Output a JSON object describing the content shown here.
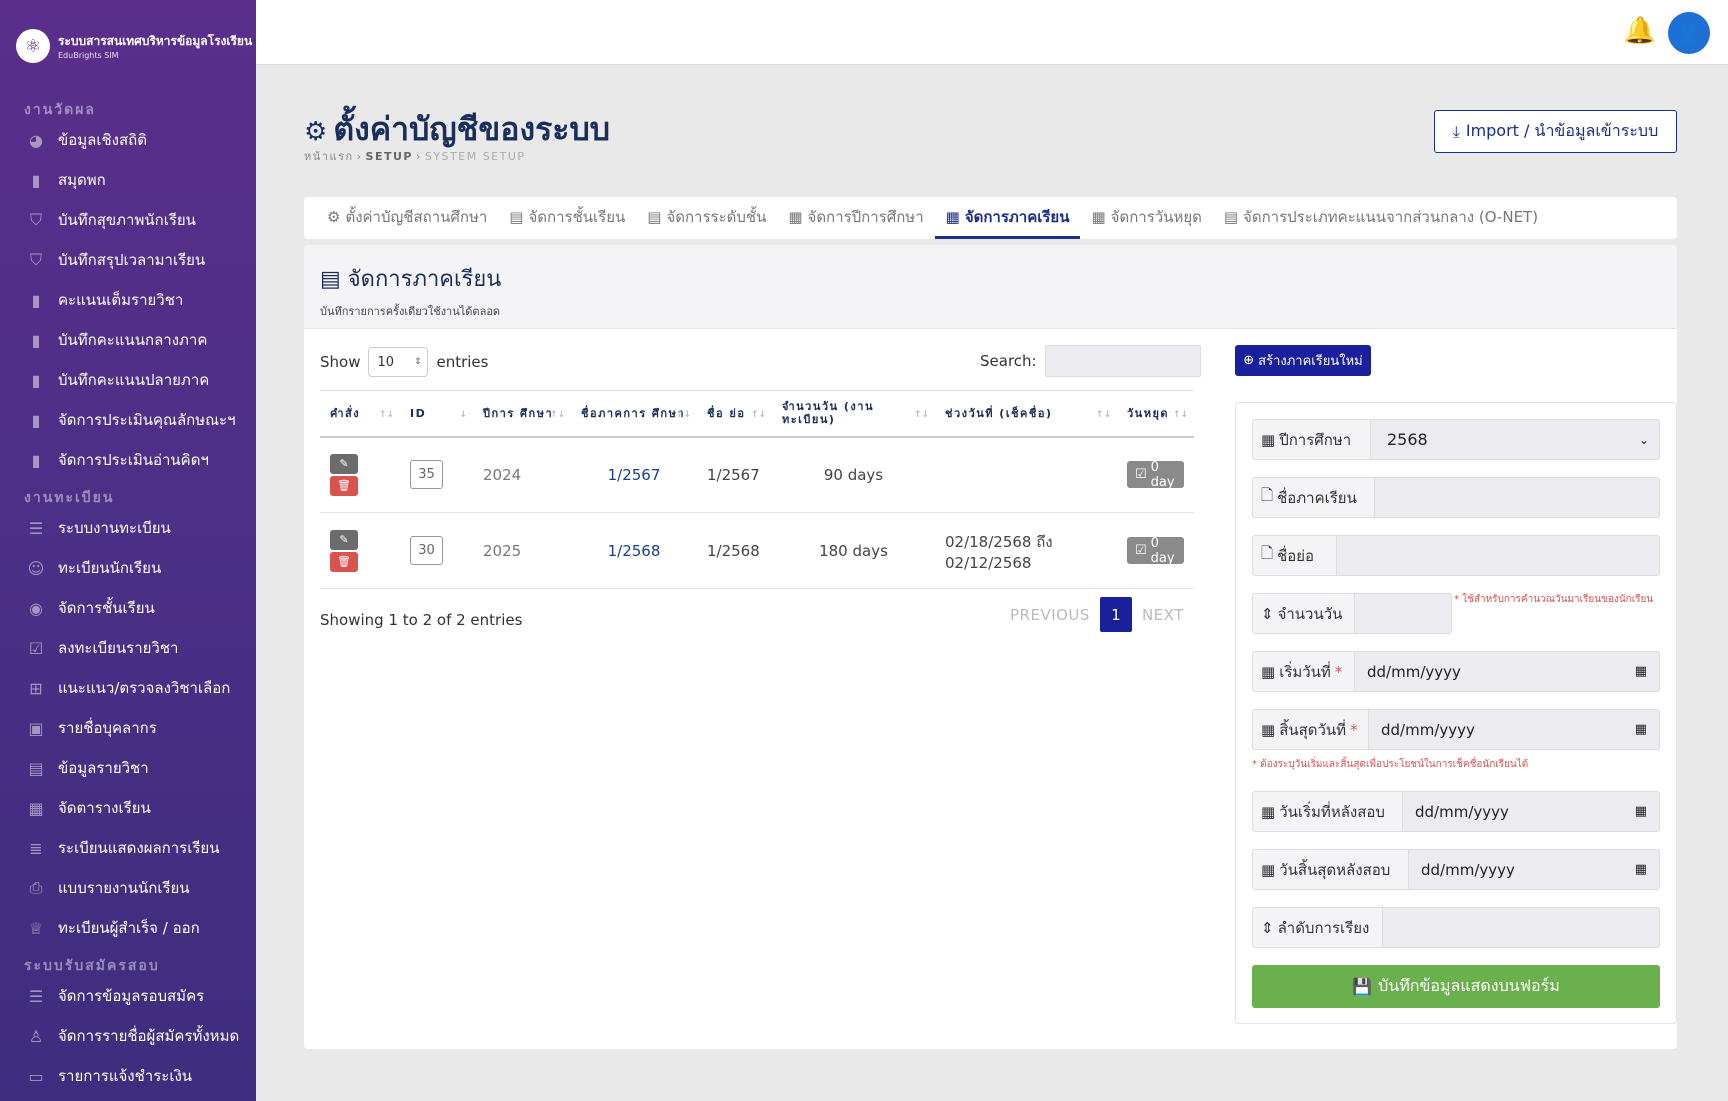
{
  "brand": {
    "title": "ระบบสารสนเทศบริหารข้อมูลโรงเรียน",
    "subtitle": "EduBrights SIM"
  },
  "sidebar": {
    "sections": [
      {
        "title": "งานวัดผล",
        "items": [
          {
            "label": "ข้อมูลเชิงสถิติ",
            "icon": "chart-pie-icon"
          },
          {
            "label": "สมุดพก",
            "icon": "book-icon"
          },
          {
            "label": "บันทึกสุขภาพนักเรียน",
            "icon": "shield-icon"
          },
          {
            "label": "บันทึกสรุปเวลามาเรียน",
            "icon": "shield-icon"
          },
          {
            "label": "คะแนนเต็มรายวิชา",
            "icon": "book-icon"
          },
          {
            "label": "บันทึกคะแนนกลางภาค",
            "icon": "book-icon"
          },
          {
            "label": "บันทึกคะแนนปลายภาค",
            "icon": "book-icon"
          },
          {
            "label": "จัดการประเมินคุณลักษณะฯ",
            "icon": "book-icon"
          },
          {
            "label": "จัดการประเมินอ่านคิดฯ",
            "icon": "book-icon"
          }
        ]
      },
      {
        "title": "งานทะเบียน",
        "items": [
          {
            "label": "ระบบงานทะเบียน",
            "icon": "list-icon"
          },
          {
            "label": "ทะเบียนนักเรียน",
            "icon": "face-icon"
          },
          {
            "label": "จัดการชั้นเรียน",
            "icon": "user-circle-icon"
          },
          {
            "label": "ลงทะเบียนรายวิชา",
            "icon": "checklist-icon"
          },
          {
            "label": "แนะแนว/ตรวจลงวิชาเลือก",
            "icon": "plus-box-icon"
          },
          {
            "label": "รายชื่อบุคลากร",
            "icon": "badge-icon"
          },
          {
            "label": "ข้อมูลรายวิชา",
            "icon": "open-book-icon"
          },
          {
            "label": "จัดตารางเรียน",
            "icon": "calendar-icon"
          },
          {
            "label": "ระเบียนแสดงผลการเรียน",
            "icon": "lines-icon"
          },
          {
            "label": "แบบรายงานนักเรียน",
            "icon": "printer-icon"
          },
          {
            "label": "ทะเบียนผู้สำเร็จ / ออก",
            "icon": "graduation-cap-icon"
          }
        ]
      },
      {
        "title": "ระบบรับสมัครสอบ",
        "items": [
          {
            "label": "จัดการข้อมูลรอบสมัคร",
            "icon": "list-icon"
          },
          {
            "label": "จัดการรายชื่อผู้สมัครทั้งหมด",
            "icon": "user-icon"
          },
          {
            "label": "รายการแจ้งชำระเงิน",
            "icon": "payment-icon"
          }
        ]
      }
    ]
  },
  "page": {
    "title": "ตั้งค่าบัญชีของระบบ",
    "breadcrumb": [
      "หน้าแรก",
      "SETUP",
      "SYSTEM SETUP"
    ],
    "import_label": "Import / นำข้อมูลเข้าระบบ"
  },
  "tabs": [
    {
      "label": "ตั้งค่าบัญชีสถานศึกษา",
      "icon": "gear-icon",
      "active": false
    },
    {
      "label": "จัดการชั้นเรียน",
      "icon": "list-alt-icon",
      "active": false
    },
    {
      "label": "จัดการระดับชั้น",
      "icon": "list-alt-icon",
      "active": false
    },
    {
      "label": "จัดการปีการศึกษา",
      "icon": "calendar-icon",
      "active": false
    },
    {
      "label": "จัดการภาคเรียน",
      "icon": "calendar-icon",
      "active": true
    },
    {
      "label": "จัดการวันหยุด",
      "icon": "calendar-icon",
      "active": false
    },
    {
      "label": "จัดการประเภทคะแนนจากส่วนกลาง (O-NET)",
      "icon": "list-alt-icon",
      "active": false
    }
  ],
  "card": {
    "title": "จัดการภาคเรียน",
    "subtitle": "บันทึกรายการครั้งเดียวใช้งานได้ตลอด"
  },
  "table": {
    "show_label": "Show",
    "entries_label": "entries",
    "length_value": "10",
    "search_label": "Search:",
    "columns": [
      "คำสั่ง",
      "ID",
      "ปีการ ศึกษา",
      "ชื่อภาคการ ศึกษา",
      "ชื่อ ย่อ",
      "จำนวนวัน (งาน ทะเบียน)",
      "ช่วงวันที่ (เช็คชื่อ)",
      "วันหยุด"
    ],
    "rows": [
      {
        "id": "35",
        "year": "2024",
        "term_name": "1/2567",
        "short": "1/2567",
        "days": "90 days",
        "range1": "",
        "range2": "",
        "holiday": "0 day"
      },
      {
        "id": "30",
        "year": "2025",
        "term_name": "1/2568",
        "short": "1/2568",
        "days": "180 days",
        "range1": "02/18/2568 ถึง",
        "range2": "02/12/2568",
        "holiday": "0 day"
      }
    ],
    "info": "Showing 1 to 2 of 2 entries",
    "pager": {
      "prev": "PREVIOUS",
      "current": "1",
      "next": "NEXT"
    }
  },
  "form": {
    "new_button": "สร้างภาคเรียนใหม่",
    "year_label": "ปีการศึกษา",
    "year_value": "2568",
    "term_label": "ชื่อภาคเรียน",
    "short_label": "ชื่อย่อ",
    "days_label": "จำนวนวัน",
    "days_note": "* ใช้สำหรับการคำนวณวันมาเรียนของนักเรียน",
    "start_label": "เริ่มวันที่",
    "end_label": "สิ้นสุดวันที่",
    "required_mark": "*",
    "date_placeholder": "dd/mm/yyyy",
    "date_note": "* ต้องระบุวันเริ่มและสิ้นสุดเพื่อประโยชน์ในการเช็คชื่อนักเรียนได้",
    "exam_start_label": "วันเริ่มที่หลังสอบ",
    "exam_end_label": "วันสิ้นสุดหลังสอบ",
    "order_label": "ลำดับการเรียง",
    "save_button": "บันทึกข้อมูลแสดงบนฟอร์ม"
  }
}
